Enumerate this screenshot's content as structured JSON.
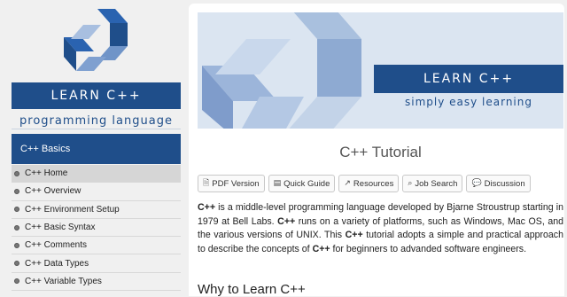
{
  "colors": {
    "brand": "#1f4e8a",
    "brand_light": "#dbe5f1"
  },
  "sidebar": {
    "banner": "LEARN C++",
    "tagline": "programming language",
    "section_title": "C++ Basics",
    "items": [
      {
        "label": "C++ Home",
        "active": true
      },
      {
        "label": "C++ Overview"
      },
      {
        "label": "C++ Environment Setup"
      },
      {
        "label": "C++ Basic Syntax"
      },
      {
        "label": "C++ Comments"
      },
      {
        "label": "C++ Data Types"
      },
      {
        "label": "C++ Variable Types"
      }
    ]
  },
  "hero": {
    "banner": "LEARN C++",
    "tagline": "simply easy learning"
  },
  "main": {
    "title": "C++ Tutorial",
    "toolbar": [
      {
        "label": "PDF Version",
        "icon": "pdf-icon"
      },
      {
        "label": "Quick Guide",
        "icon": "guide-icon"
      },
      {
        "label": "Resources",
        "icon": "external-link-icon"
      },
      {
        "label": "Job Search",
        "icon": "search-icon"
      },
      {
        "label": "Discussion",
        "icon": "chat-icon"
      }
    ],
    "intro": {
      "b1": "C++",
      "t1": " is a middle-level programming language developed by Bjarne Stroustrup starting in 1979 at Bell Labs. ",
      "b2": "C++",
      "t2": " runs on a variety of platforms, such as Windows, Mac OS, and the various versions of UNIX. This ",
      "b3": "C++",
      "t3": " tutorial adopts a simple and practical approach to describe the concepts of ",
      "b4": "C++",
      "t4": " for beginners to advanded software engineers."
    },
    "heading2": "Why to Learn C++"
  }
}
